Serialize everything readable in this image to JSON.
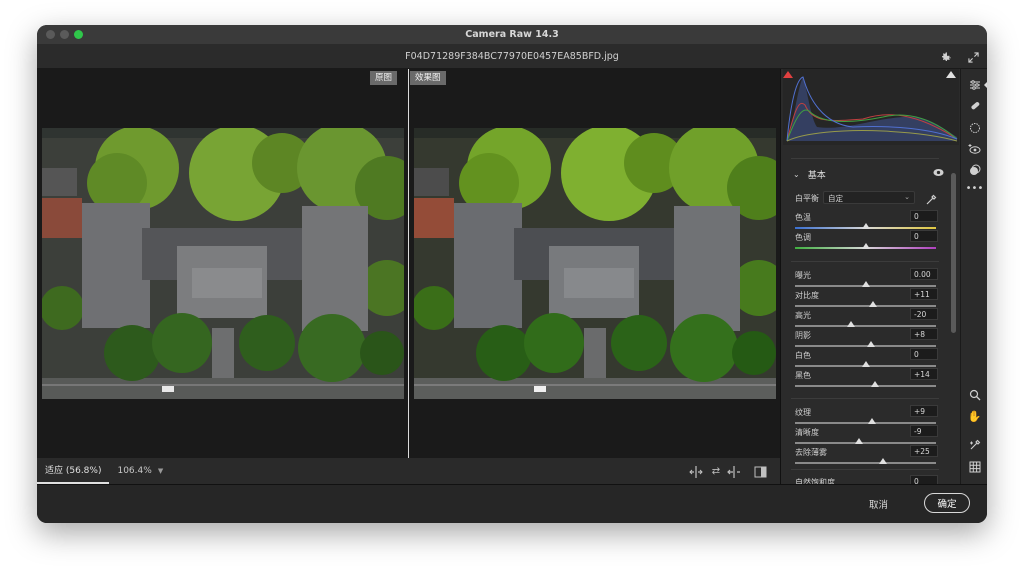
{
  "window": {
    "title": "Camera Raw 14.3"
  },
  "file": {
    "name": "F04D71289F384BC77970E0457EA85BFD.jpg"
  },
  "preview": {
    "before_label": "原图",
    "after_label": "效果图"
  },
  "bottombar": {
    "fit_label": "适应 (56.8%)",
    "zoom_value": "106.4%"
  },
  "footer": {
    "cancel_label": "取消",
    "ok_label": "确定"
  },
  "panel": {
    "section_title": "基本",
    "white_balance": {
      "label": "白平衡",
      "value": "自定"
    },
    "sliders": [
      {
        "label": "色温",
        "value": "0",
        "pos": 0.5,
        "track": "temp"
      },
      {
        "label": "色调",
        "value": "0",
        "pos": 0.5,
        "track": "tint"
      },
      {
        "label": "曝光",
        "value": "0.00",
        "pos": 0.5,
        "track": "plain"
      },
      {
        "label": "对比度",
        "value": "+11",
        "pos": 0.555,
        "track": "plain"
      },
      {
        "label": "高光",
        "value": "-20",
        "pos": 0.4,
        "track": "plain"
      },
      {
        "label": "阴影",
        "value": "+8",
        "pos": 0.54,
        "track": "plain"
      },
      {
        "label": "白色",
        "value": "0",
        "pos": 0.5,
        "track": "plain"
      },
      {
        "label": "黑色",
        "value": "+14",
        "pos": 0.57,
        "track": "plain"
      },
      {
        "label": "纹理",
        "value": "+9",
        "pos": 0.545,
        "track": "plain"
      },
      {
        "label": "清晰度",
        "value": "-9",
        "pos": 0.455,
        "track": "plain"
      },
      {
        "label": "去除薄雾",
        "value": "+25",
        "pos": 0.625,
        "track": "plain"
      },
      {
        "label": "自然饱和度",
        "value": "0",
        "pos": 0.5,
        "track": "plain"
      }
    ]
  },
  "icons": {
    "gear": "gear-icon",
    "expand": "expand-icon",
    "eye": "eye-icon",
    "eyedropper": "eyedropper-icon"
  },
  "colors": {
    "accent": "#e0e0e0",
    "window_bg": "#1e1e1e",
    "panel_bg": "#2b2b2b",
    "clip_warning": "#e04040"
  }
}
